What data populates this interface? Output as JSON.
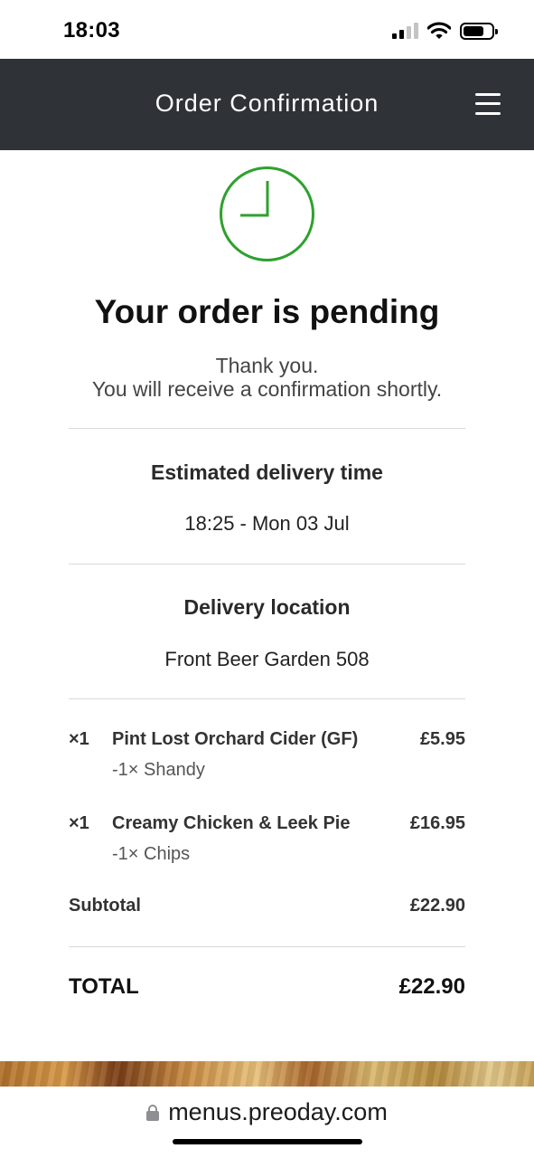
{
  "status_bar": {
    "time": "18:03",
    "icons": [
      "cellular-signal-icon",
      "wifi-icon",
      "battery-icon"
    ]
  },
  "header": {
    "title": "Order Confirmation",
    "menu_icon": "hamburger-menu-icon",
    "background": "#2f3337"
  },
  "status": {
    "icon": "clock-icon",
    "icon_color": "#2ea12e",
    "title": "Your order is pending",
    "message_line1": "Thank you.",
    "message_line2": "You will receive a confirmation shortly."
  },
  "delivery_time": {
    "label": "Estimated delivery time",
    "value": "18:25 - Mon 03 Jul"
  },
  "delivery_location": {
    "label": "Delivery location",
    "value": "Front Beer Garden 508"
  },
  "items": [
    {
      "qty": "×1",
      "name": "Pint Lost Orchard Cider (GF)",
      "price": "£5.95",
      "modifier": "-1× Shandy"
    },
    {
      "qty": "×1",
      "name": "Creamy Chicken & Leek Pie",
      "price": "£16.95",
      "modifier": "-1× Chips"
    }
  ],
  "subtotal": {
    "label": "Subtotal",
    "value": "£22.90"
  },
  "total": {
    "label": "TOTAL",
    "value": "£22.90"
  },
  "browser": {
    "url": "menus.preoday.com",
    "lock_icon": "lock-icon"
  }
}
